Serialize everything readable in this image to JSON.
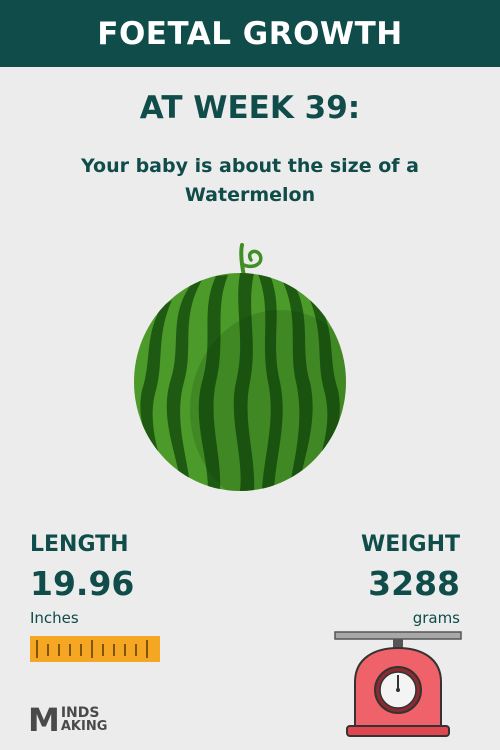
{
  "header": {
    "title": "FOETAL GROWTH"
  },
  "week": {
    "label": "AT WEEK 39:"
  },
  "subtitle": {
    "line1": "Your baby is about the size of a",
    "line2": "Watermelon"
  },
  "fruit": {
    "icon": "watermelon-icon"
  },
  "length": {
    "label": "LENGTH",
    "value": "19.96",
    "unit": "Inches",
    "icon": "ruler-icon"
  },
  "weight": {
    "label": "WEIGHT",
    "value": "3288",
    "unit": "grams",
    "icon": "kitchen-scale-icon"
  },
  "logo": {
    "letter": "M",
    "word1": "INDS",
    "word2": "AKING"
  },
  "colors": {
    "primary": "#0f4c4a",
    "background": "#ececec",
    "ruler": "#f5a623",
    "scale": "#f0626a",
    "watermelon_light": "#4c9a2a",
    "watermelon_dark": "#1e5a12"
  }
}
